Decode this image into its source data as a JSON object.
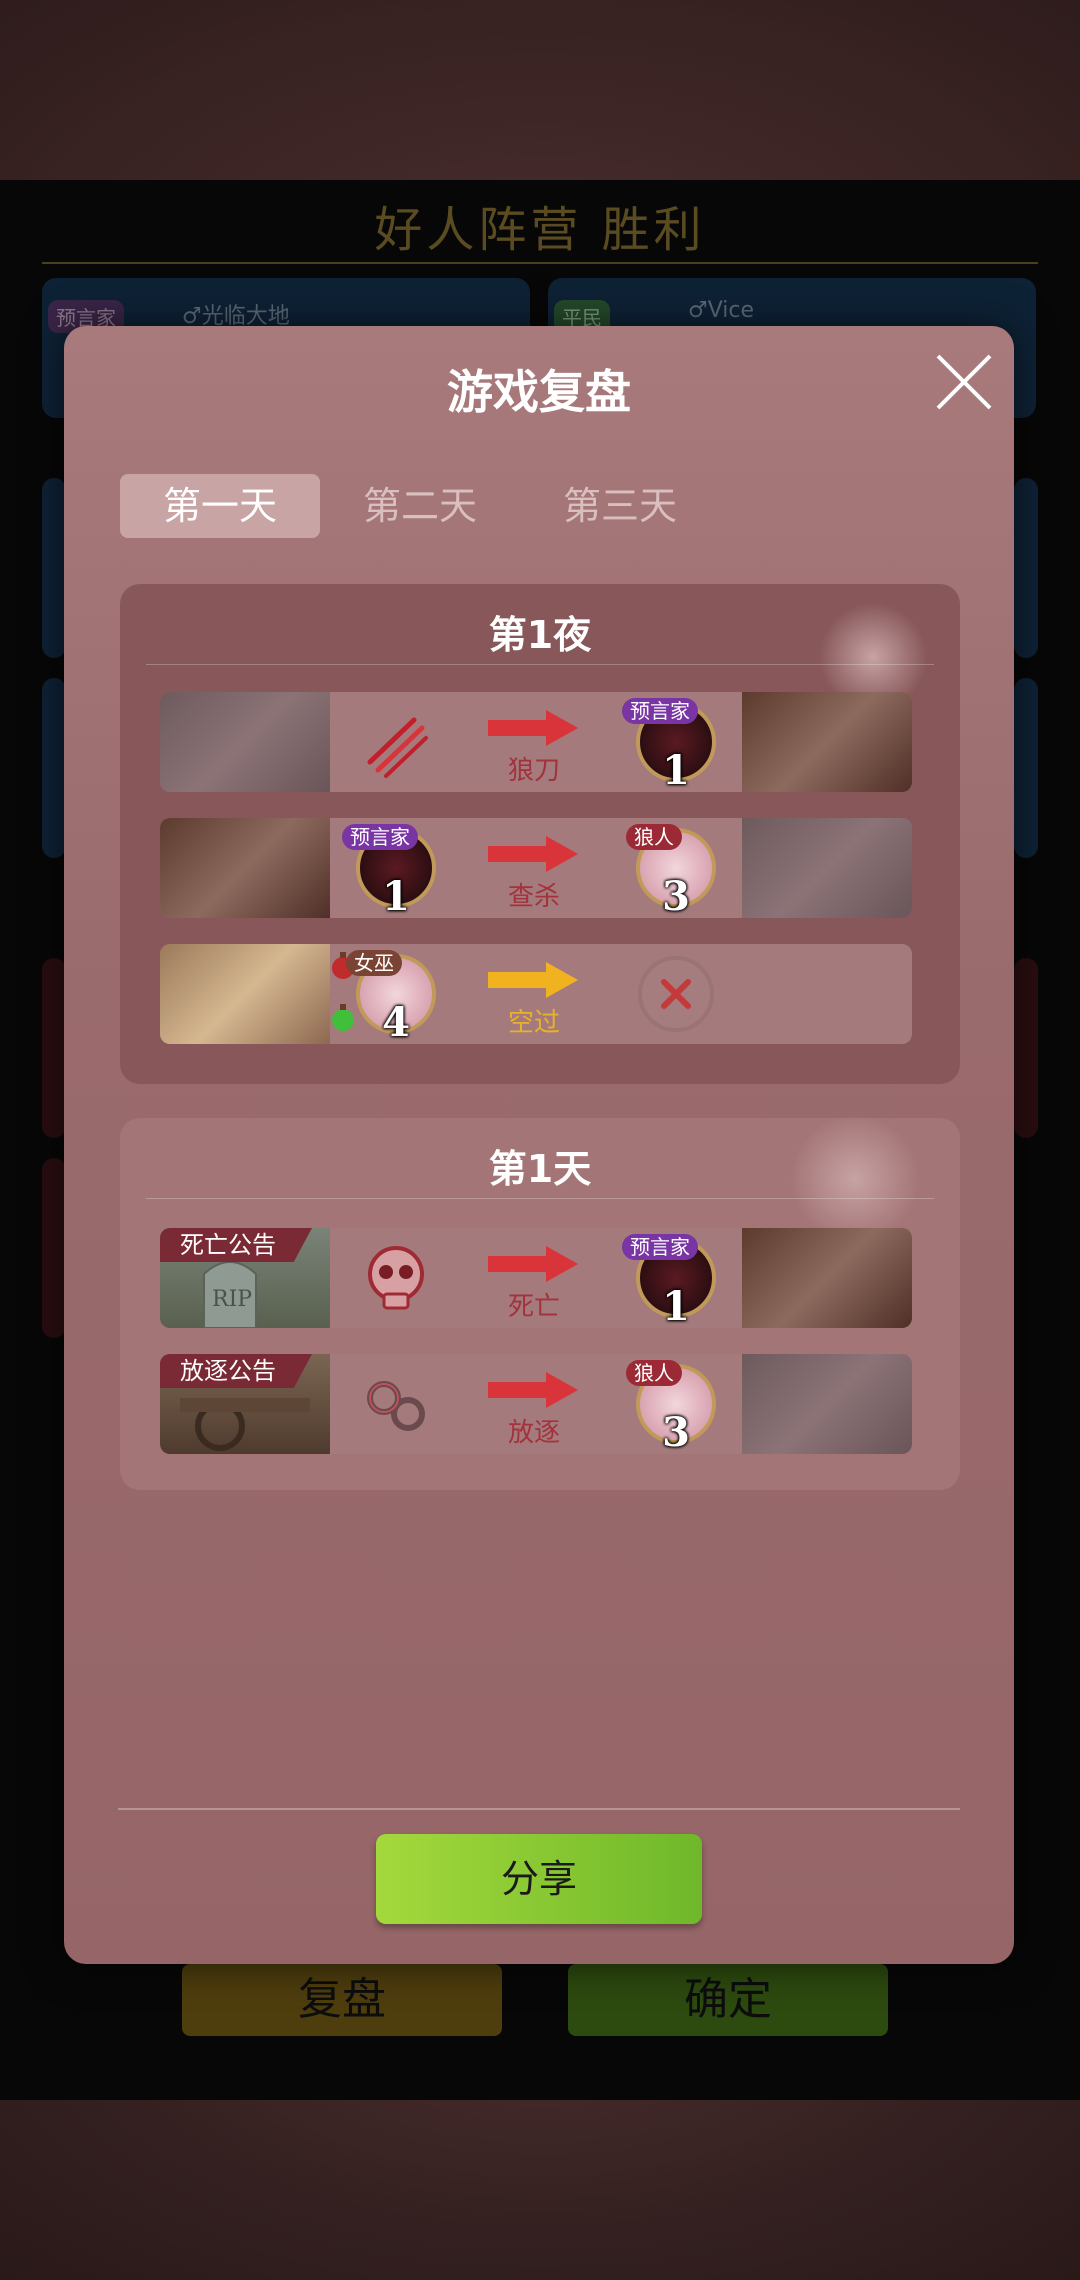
{
  "background": {
    "result_title": "好人阵营 胜利",
    "cards": [
      {
        "tag": "预言家",
        "nick": "♂光临大地"
      },
      {
        "tag": "平民",
        "nick": "♂Vice"
      }
    ],
    "buttons": {
      "review": "复盘",
      "confirm": "确定"
    }
  },
  "modal": {
    "title": "游戏复盘",
    "close_icon": "close-icon",
    "tabs": [
      {
        "label": "第一天",
        "active": true
      },
      {
        "label": "第二天",
        "active": false
      },
      {
        "label": "第三天",
        "active": false
      }
    ],
    "night": {
      "title": "第1夜",
      "rows": [
        {
          "actor": "werewolf",
          "action_icon": "claw-slash-icon",
          "arrow_label": "狼刀",
          "target_tag": "预言家",
          "target_number": "1"
        },
        {
          "actor": "seer",
          "actor_tag": "预言家",
          "actor_number": "1",
          "arrow_label": "查杀",
          "target_tag": "狼人",
          "target_number": "3"
        },
        {
          "actor": "witch",
          "actor_tag": "女巫",
          "actor_number": "4",
          "arrow_label": "空过",
          "target": "none-icon"
        }
      ]
    },
    "day": {
      "title": "第1天",
      "rows": [
        {
          "announcement": "死亡公告",
          "action_icon": "skull-icon",
          "arrow_label": "死亡",
          "target_tag": "预言家",
          "target_number": "1"
        },
        {
          "announcement": "放逐公告",
          "action_icon": "shackles-icon",
          "arrow_label": "放逐",
          "target_tag": "狼人",
          "target_number": "3"
        }
      ]
    },
    "share_label": "分享"
  },
  "colors": {
    "modal_bg": "#9d6d6f",
    "night_section": "#875759",
    "day_section": "#a47576",
    "tab_active": "#c9a4a5",
    "arrow_red": "#d8343a",
    "arrow_yellow": "#f0b21e",
    "share_green": "#8cc836",
    "role_purple": "#7a35a4",
    "role_red": "#9b2a36"
  }
}
